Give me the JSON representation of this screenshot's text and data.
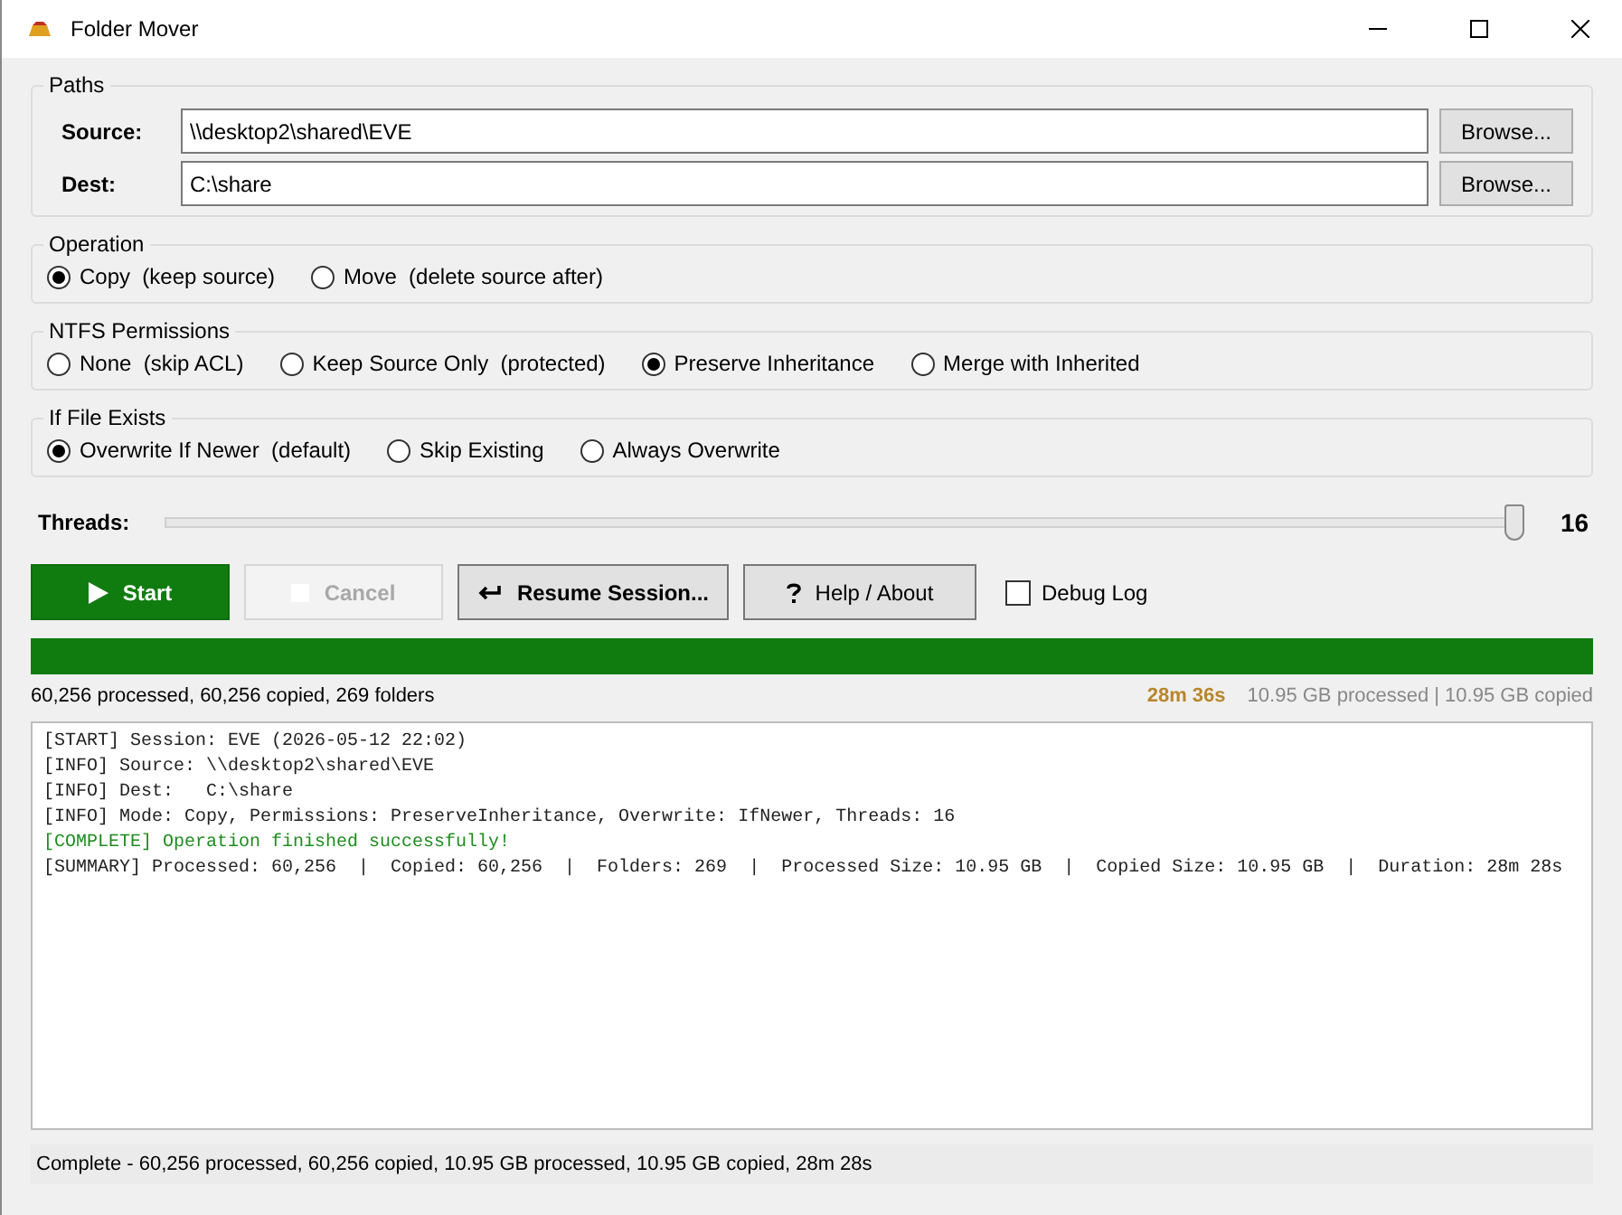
{
  "window": {
    "title": "Folder Mover"
  },
  "paths": {
    "title": "Paths",
    "fields": [
      {
        "label": "Source:",
        "value": "\\\\desktop2\\shared\\EVE",
        "button": "Browse..."
      },
      {
        "label": "Dest:",
        "value": "C:\\share",
        "button": "Browse..."
      }
    ]
  },
  "option_groups": [
    {
      "title": "Operation",
      "options": [
        {
          "label": "Copy  (keep source)",
          "selected": true
        },
        {
          "label": "Move  (delete source after)",
          "selected": false
        }
      ]
    },
    {
      "title": "NTFS Permissions",
      "options": [
        {
          "label": "None  (skip ACL)",
          "selected": false
        },
        {
          "label": "Keep Source Only  (protected)",
          "selected": false
        },
        {
          "label": "Preserve Inheritance",
          "selected": true
        },
        {
          "label": "Merge with Inherited",
          "selected": false
        }
      ]
    },
    {
      "title": "If File Exists",
      "options": [
        {
          "label": "Overwrite If Newer  (default)",
          "selected": true
        },
        {
          "label": "Skip Existing",
          "selected": false
        },
        {
          "label": "Always Overwrite",
          "selected": false
        }
      ]
    }
  ],
  "threads": {
    "label": "Threads:",
    "level": 1.0,
    "reading": "16"
  },
  "buttons": [
    {
      "kind": "start",
      "label": "Start",
      "disabled": false
    },
    {
      "kind": "cancel",
      "label": "Cancel",
      "disabled": true
    },
    {
      "kind": "resume",
      "label": "Resume Session...",
      "disabled": false
    },
    {
      "kind": "help",
      "label": "Help / About",
      "disabled": false
    }
  ],
  "debug_log": {
    "label": "Debug Log",
    "checked": false
  },
  "progress": {
    "level": 1.0,
    "summary": "60,256 processed, 60,256 copied, 269 folders",
    "elapsed": "28m 36s",
    "sizes": "10.95 GB processed | 10.95 GB copied"
  },
  "log": [
    {
      "kind": "normal",
      "text": "[START] Session: EVE (2026-05-12 22:02)"
    },
    {
      "kind": "normal",
      "text": "[INFO] Source: \\\\desktop2\\shared\\EVE"
    },
    {
      "kind": "normal",
      "text": "[INFO] Dest:   C:\\share"
    },
    {
      "kind": "normal",
      "text": "[INFO] Mode: Copy, Permissions: PreserveInheritance, Overwrite: IfNewer, Threads: 16"
    },
    {
      "kind": "success",
      "text": "[COMPLETE] Operation finished successfully!"
    },
    {
      "kind": "normal",
      "text": "[SUMMARY] Processed: 60,256  |  Copied: 60,256  |  Folders: 269  |  Processed Size: 10.95 GB  |  Copied Size: 10.95 GB  |  Duration: 28m 28s"
    }
  ],
  "status_bar": "Complete - 60,256 processed, 60,256 copied, 10.95 GB processed, 10.95 GB copied, 28m 28s"
}
